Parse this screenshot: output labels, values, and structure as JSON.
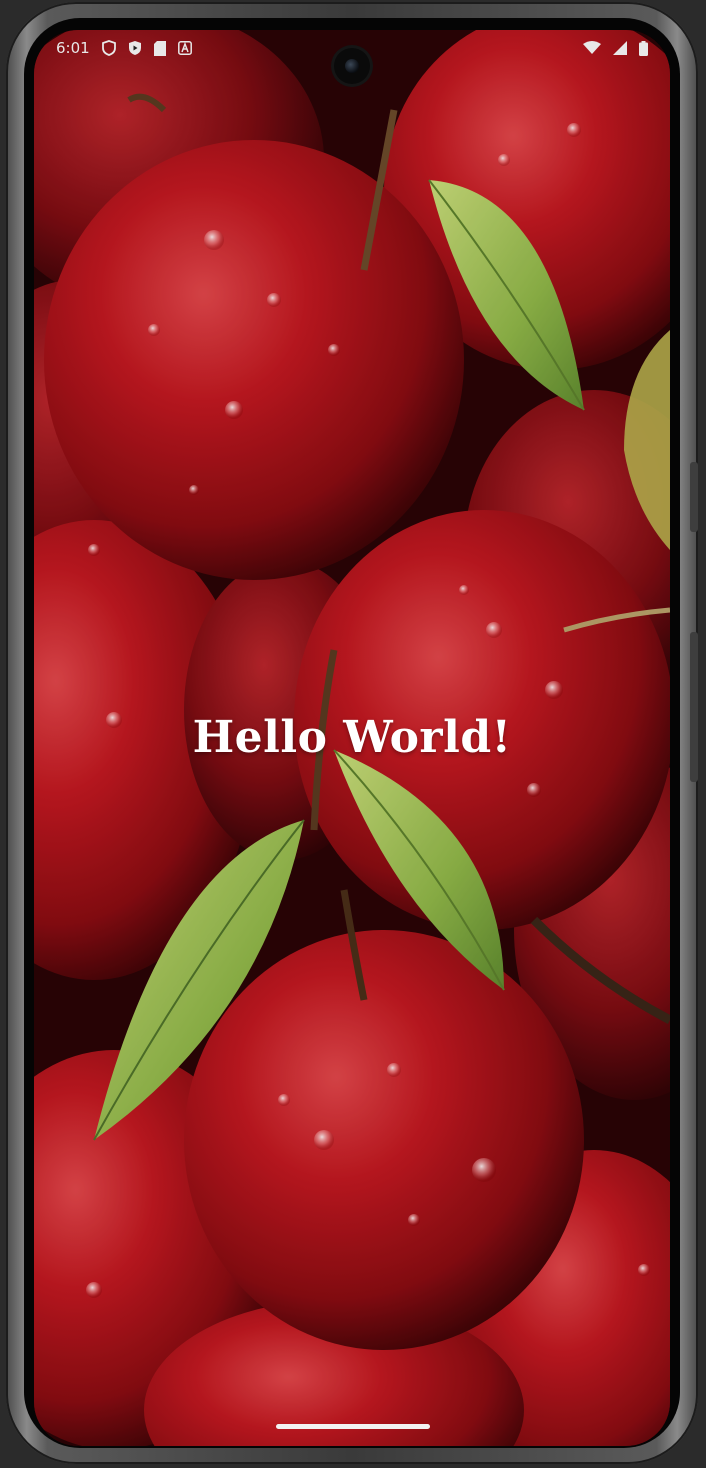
{
  "status_bar": {
    "time": "6:01",
    "left_icons": [
      "shield-icon",
      "play-protect-icon",
      "sd-card-icon",
      "a-badge-icon"
    ],
    "right_icons": [
      "wifi-icon",
      "cellular-signal-icon",
      "battery-icon"
    ]
  },
  "main": {
    "greeting": "Hello World!"
  },
  "colors": {
    "text": "#ffffff",
    "apple_red": "#b3121b",
    "leaf_green": "#a7c95a",
    "status_text": "#e8e8e8"
  }
}
